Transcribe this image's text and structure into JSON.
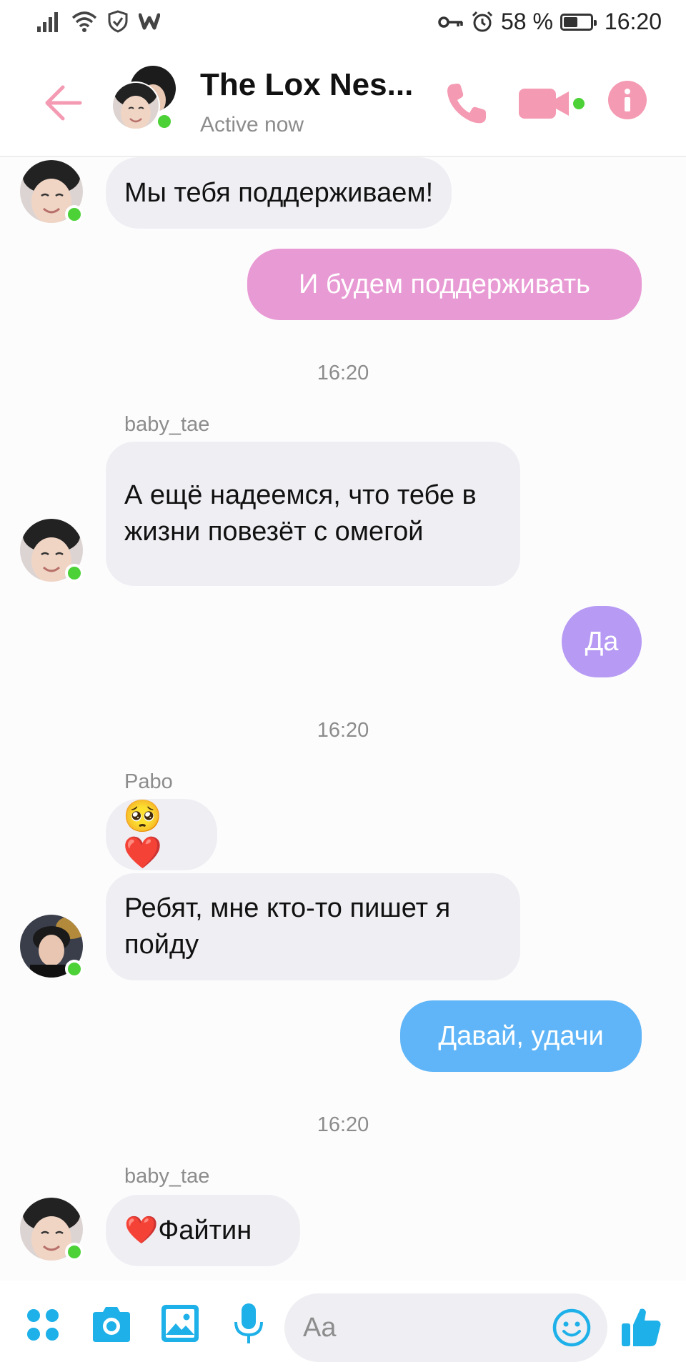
{
  "status_bar": {
    "battery_percent": "58 %",
    "battery_level": 0.58,
    "time": "16:20",
    "icons": [
      "signal-icon",
      "wifi-icon",
      "shield-icon",
      "wattpad-icon",
      "key-icon",
      "alarm-icon",
      "battery-icon"
    ]
  },
  "header": {
    "title": "The Lox Nes...",
    "subtitle": "Active now",
    "icons": [
      "back-arrow-icon",
      "phone-icon",
      "video-camera-icon",
      "info-icon"
    ]
  },
  "colors": {
    "accent": "#f49ab3",
    "online": "#4cd137",
    "incoming_bubble": "#efeef3",
    "bubble_pink": "#e89ad4",
    "bubble_purple": "#b69af4",
    "bubble_blue": "#5fb5f7",
    "composer_icons": "#1eb0e8"
  },
  "messages": [
    {
      "type": "incoming",
      "text": "Мы тебя поддерживаем!"
    },
    {
      "type": "outgoing",
      "text": "И будем поддерживать"
    },
    {
      "type": "timestamp",
      "text": "16:20"
    },
    {
      "type": "sender",
      "text": "baby_tae"
    },
    {
      "type": "incoming",
      "text": "А ещё надеемся, что тебе в жизни повезёт с омегой"
    },
    {
      "type": "outgoing",
      "text": "Да"
    },
    {
      "type": "timestamp",
      "text": "16:20"
    },
    {
      "type": "sender",
      "text": "Pabo"
    },
    {
      "type": "incoming",
      "text": "🥺❤️"
    },
    {
      "type": "incoming",
      "text": "Ребят, мне кто-то пишет я пойду"
    },
    {
      "type": "outgoing",
      "text": "Давай, удачи"
    },
    {
      "type": "timestamp",
      "text": "16:20"
    },
    {
      "type": "sender",
      "text": "baby_tae"
    },
    {
      "type": "incoming",
      "text": "❤️Файтин"
    }
  ],
  "composer": {
    "placeholder": "Aa",
    "icons": [
      "apps-grid-icon",
      "camera-icon",
      "gallery-icon",
      "microphone-icon",
      "emoji-icon",
      "thumbs-up-icon"
    ]
  }
}
